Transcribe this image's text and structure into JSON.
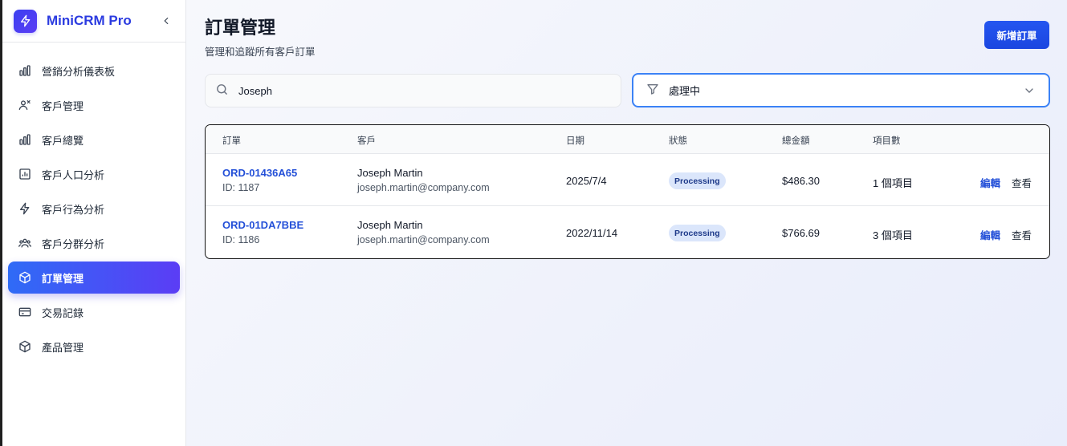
{
  "app": {
    "name": "MiniCRM Pro",
    "accent": "#2b3be0"
  },
  "sidebar": {
    "items": [
      {
        "label": "營銷分析儀表板",
        "icon": "bar-chart-icon",
        "active": false
      },
      {
        "label": "客戶管理",
        "icon": "users-icon",
        "active": false
      },
      {
        "label": "客戶總覽",
        "icon": "bar-chart-icon",
        "active": false
      },
      {
        "label": "客戶人口分析",
        "icon": "chart-square-icon",
        "active": false
      },
      {
        "label": "客戶行為分析",
        "icon": "lightning-icon",
        "active": false
      },
      {
        "label": "客戶分群分析",
        "icon": "user-group-icon",
        "active": false
      },
      {
        "label": "訂單管理",
        "icon": "box-icon",
        "active": true
      },
      {
        "label": "交易記錄",
        "icon": "credit-card-icon",
        "active": false
      },
      {
        "label": "產品管理",
        "icon": "box-icon",
        "active": false
      }
    ]
  },
  "header": {
    "title": "訂單管理",
    "subtitle": "管理和追蹤所有客戶訂單",
    "new_order_label": "新增訂單"
  },
  "search": {
    "value": "Joseph",
    "placeholder": ""
  },
  "filter": {
    "selected": "處理中"
  },
  "table": {
    "columns": [
      "訂單",
      "客戶",
      "日期",
      "狀態",
      "總金額",
      "項目數"
    ],
    "rows": [
      {
        "order_no": "ORD-01436A65",
        "order_id": "ID: 1187",
        "customer_name": "Joseph Martin",
        "customer_email": "joseph.martin@company.com",
        "date": "2025/7/4",
        "status": "Processing",
        "total": "$486.30",
        "items": "1 個項目",
        "edit_label": "編輯",
        "view_label": "查看"
      },
      {
        "order_no": "ORD-01DA7BBE",
        "order_id": "ID: 1186",
        "customer_name": "Joseph Martin",
        "customer_email": "joseph.martin@company.com",
        "date": "2022/11/14",
        "status": "Processing",
        "total": "$766.69",
        "items": "3 個項目",
        "edit_label": "編輯",
        "view_label": "查看"
      }
    ]
  }
}
